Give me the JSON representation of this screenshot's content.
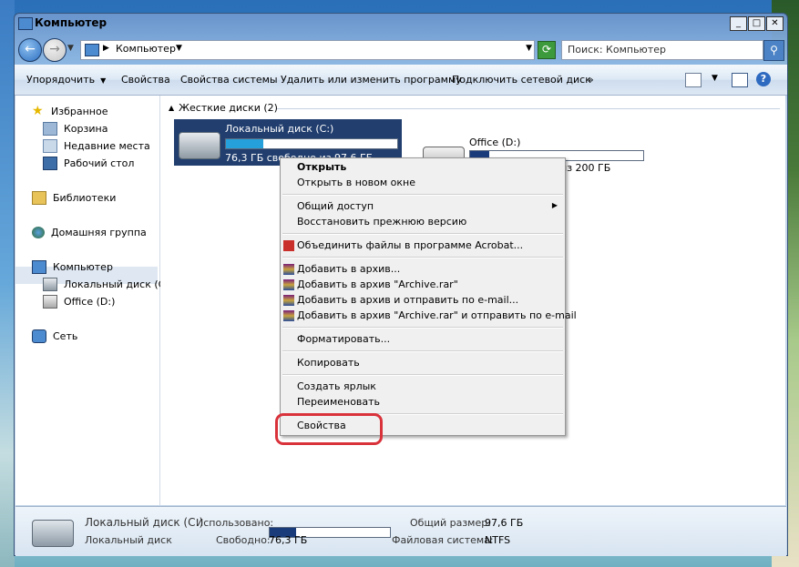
{
  "window": {
    "title": "Компьютер"
  },
  "address": {
    "path": "Компьютер"
  },
  "search": {
    "placeholder": "Поиск: Компьютер"
  },
  "toolbar": {
    "organize": "Упорядочить",
    "properties": "Свойства",
    "system_properties": "Свойства системы",
    "uninstall": "Удалить или изменить программу",
    "map_drive": "Подключить сетевой диск",
    "more": "»"
  },
  "nav": {
    "favorites": "Избранное",
    "cart": "Корзина",
    "recent": "Недавние места",
    "desktop": "Рабочий стол",
    "libraries": "Библиотеки",
    "homegroup": "Домашняя группа",
    "computer": "Компьютер",
    "drive_c": "Локальный диск (C:)",
    "drive_d": "Office (D:)",
    "network": "Сеть"
  },
  "content": {
    "group_header": "Жесткие диски (2)",
    "drives": [
      {
        "name": "Локальный диск (C:)",
        "free": "76,3 ГБ свободно из 97,6 ГБ",
        "used_fraction": 0.22
      },
      {
        "name": "Office (D:)",
        "free": "177 ГБ свободно из 200 ГБ",
        "used_fraction": 0.11
      }
    ]
  },
  "context_menu": {
    "open": "Открыть",
    "open_new_window": "Открыть в новом окне",
    "sharing": "Общий доступ",
    "restore": "Восстановить прежнюю версию",
    "acrobat": "Объединить файлы в программе Acrobat...",
    "archive1": "Добавить в архив...",
    "archive2": "Добавить в архив \"Archive.rar\"",
    "archive3": "Добавить в архив и отправить по e-mail...",
    "archive4": "Добавить в архив \"Archive.rar\" и отправить по e-mail",
    "format": "Форматировать...",
    "copy": "Копировать",
    "shortcut": "Создать ярлык",
    "rename": "Переименовать",
    "properties": "Свойства"
  },
  "details": {
    "name": "Локальный диск (C:)",
    "type": "Локальный диск",
    "used_label": "Использовано:",
    "used_fraction": 0.22,
    "free_label": "Свободно:",
    "free_value": "76,3 ГБ",
    "total_label": "Общий размер:",
    "total_value": "97,6 ГБ",
    "fs_label": "Файловая система:",
    "fs_value": "NTFS"
  },
  "colors": {
    "selection": "#213e6e",
    "highlight_ring": "#d9323b",
    "bar_fill": "#26a0da"
  }
}
